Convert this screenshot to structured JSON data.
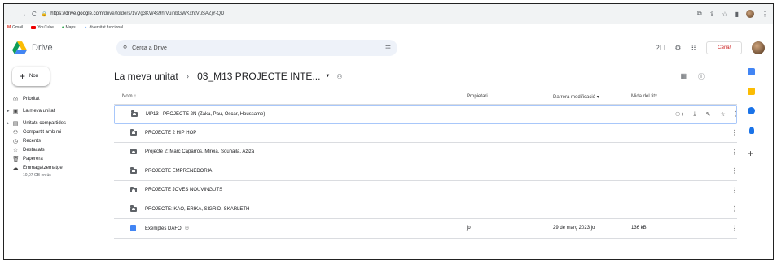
{
  "browser": {
    "url_host": "https://drive.google.com",
    "url_path": "/drive/folders/1vVg3KW4s9hfVuinbGWKxhtVuSAZjY-QD",
    "bookmarks": [
      "Gmail",
      "YouTube",
      "Maps",
      "diversitat funcional"
    ]
  },
  "drive": {
    "app_name": "Drive",
    "search_placeholder": "Cerca a Drive",
    "new_label": "Nou",
    "brand_text": "Canal"
  },
  "sidebar": {
    "items": [
      {
        "label": "Prioritat",
        "icon": "check-circle-icon"
      },
      {
        "label": "La meva unitat",
        "icon": "drive-icon"
      },
      {
        "label": "Unitats compartides",
        "icon": "shared-drive-icon"
      },
      {
        "label": "Compartit amb mi",
        "icon": "people-icon"
      },
      {
        "label": "Recents",
        "icon": "clock-icon"
      },
      {
        "label": "Destacats",
        "icon": "star-icon"
      },
      {
        "label": "Paperera",
        "icon": "trash-icon"
      },
      {
        "label": "Emmagatzematge",
        "icon": "cloud-icon"
      }
    ],
    "storage_text": "10,07 GB en ús"
  },
  "breadcrumb": {
    "root": "La meva unitat",
    "separator": "›",
    "current": "03_M13 PROJECTE INTE..."
  },
  "table": {
    "headers": {
      "name": "Nom",
      "owner": "Propietari",
      "modified": "Darrera modificació",
      "size": "Mida del fitx"
    },
    "rows": [
      {
        "name": "MP13 - PROJECTE 2N (Zaka, Pau, Oscar, Houssame)",
        "owner": "",
        "modified": "",
        "size": ""
      },
      {
        "name": "PROJECTE 2 HIP HOP",
        "owner": "",
        "modified": "",
        "size": ""
      },
      {
        "name": "Projecte 2: Marc Caparrós, Mireia, Souhaila, Aziza",
        "owner": "",
        "modified": "",
        "size": ""
      },
      {
        "name": "PROJECTE EMPRENEDORIA",
        "owner": "",
        "modified": "",
        "size": ""
      },
      {
        "name": "PROJECTE JOVES NOUVINGUTS",
        "owner": "",
        "modified": "",
        "size": ""
      },
      {
        "name": "PROJECTE: KAO, ERIKA, SIGRID, SKARLETH",
        "owner": "",
        "modified": "",
        "size": ""
      },
      {
        "name": "Exemples DAFO",
        "owner": "jo",
        "modified": "29 de març 2023 jo",
        "size": "136 kB"
      }
    ]
  },
  "colors": {
    "accent": "#1a73e8",
    "selected_border": "#a8c7fa",
    "search_bg": "#eef2f9"
  }
}
